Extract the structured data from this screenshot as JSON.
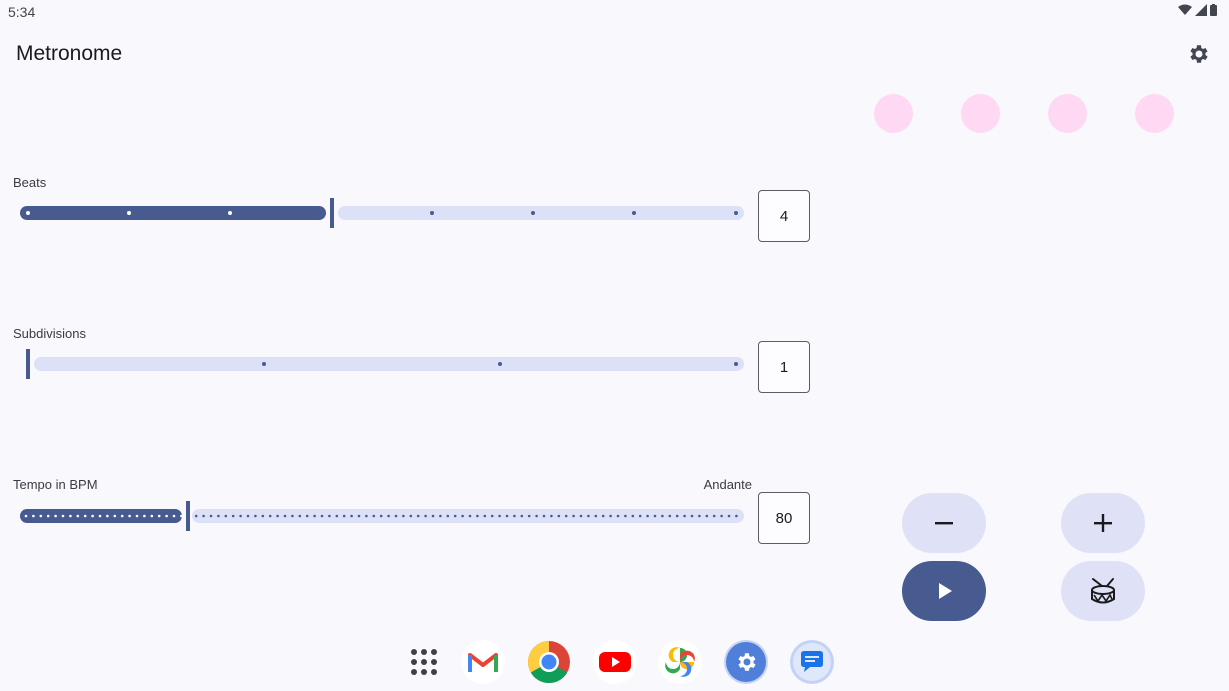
{
  "status_bar": {
    "time": "5:34"
  },
  "app": {
    "title": "Metronome"
  },
  "beats": {
    "label": "Beats",
    "value": "4",
    "min": 1,
    "max": 8,
    "current": 4
  },
  "subdivisions": {
    "label": "Subdivisions",
    "value": "1",
    "min": 1,
    "max": 4,
    "current": 1
  },
  "tempo": {
    "label": "Tempo in BPM",
    "marking": "Andante",
    "value": "80",
    "fraction": 0.23
  },
  "beat_indicators": [
    {
      "active": false
    },
    {
      "active": false
    },
    {
      "active": false
    },
    {
      "active": false
    }
  ],
  "controls": {
    "decrement_icon": "minus-icon",
    "increment_icon": "plus-icon",
    "play_icon": "play-icon",
    "drum_icon": "drum-icon"
  },
  "dock_apps": [
    "app-drawer",
    "gmail",
    "chrome",
    "youtube",
    "photos",
    "settings",
    "messages"
  ],
  "colors": {
    "accent": "#485b91",
    "track_inactive": "#dce1f7",
    "beat_indicator": "#ffd8f4",
    "button_tonal": "#dfe2f7"
  }
}
